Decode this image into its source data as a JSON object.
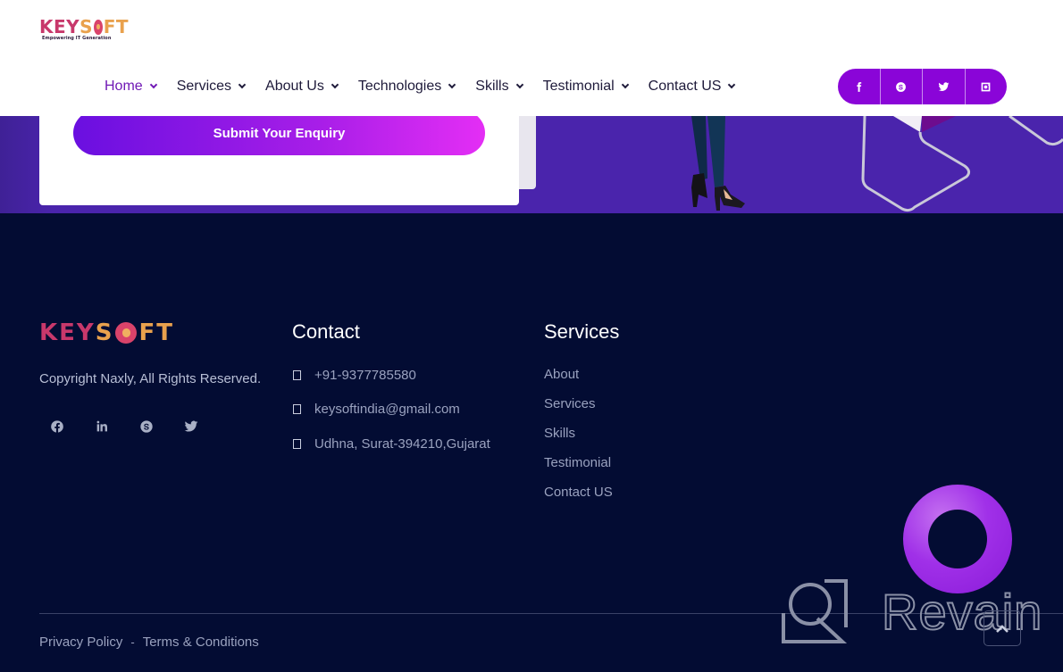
{
  "header": {
    "logo": {
      "part1": "KEY",
      "part2": "S",
      "part3": "FT",
      "tagline": "Empowering IT Generation"
    },
    "nav": [
      {
        "label": "Home",
        "active": true
      },
      {
        "label": "Services",
        "active": false
      },
      {
        "label": "About Us",
        "active": false
      },
      {
        "label": "Technologies",
        "active": false
      },
      {
        "label": "Skills",
        "active": false
      },
      {
        "label": "Testimonial",
        "active": false
      },
      {
        "label": "Contact US",
        "active": false
      }
    ],
    "social": [
      "facebook-icon",
      "skype-icon",
      "twitter-icon",
      "instagram-icon"
    ]
  },
  "banner": {
    "submit_label": "Submit Your Enquiry"
  },
  "footer": {
    "logo": {
      "part1": "KEY",
      "part2": "S",
      "part3": "FT"
    },
    "copyright": "Copyright Naxly, All Rights Reserved.",
    "social": [
      "facebook-icon",
      "linkedin-icon",
      "skype-icon",
      "twitter-icon"
    ],
    "contact": {
      "title": "Contact",
      "items": [
        {
          "icon": "phone-icon",
          "text": "+91-9377785580"
        },
        {
          "icon": "email-icon",
          "text": "keysoftindia@gmail.com"
        },
        {
          "icon": "location-icon",
          "text": "Udhna, Surat-394210,Gujarat"
        }
      ]
    },
    "services": {
      "title": "Services",
      "links": [
        "About",
        "Services",
        "Skills",
        "Testimonial",
        "Contact US"
      ]
    },
    "bottom": {
      "privacy": "Privacy Policy",
      "separator": "-",
      "terms": "Terms & Conditions"
    }
  },
  "watermark": {
    "text": "Revain"
  },
  "colors": {
    "accent_purple": "#8a05d8",
    "nav_active": "#7019b5",
    "footer_bg": "#030c33",
    "banner_bg": "#4a24ac",
    "logo_pink": "#c8386b",
    "logo_orange": "#e9a14d"
  }
}
